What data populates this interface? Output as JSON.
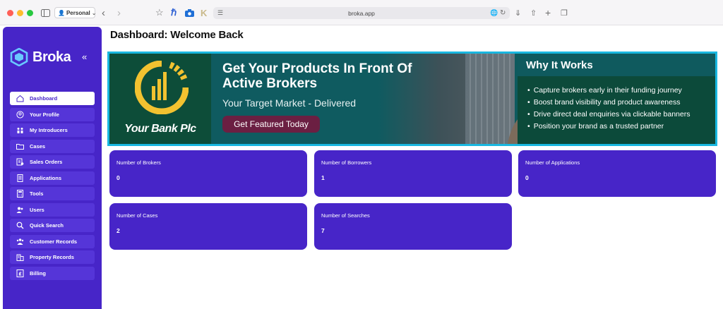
{
  "browser": {
    "profile_label": "Personal",
    "url": "broka.app"
  },
  "sidebar": {
    "brand_name": "Broka",
    "collapse_glyph": "«",
    "items": [
      {
        "label": "Dashboard",
        "icon": "home-icon",
        "active": true
      },
      {
        "label": "Your Profile",
        "icon": "user-circle-icon",
        "active": false
      },
      {
        "label": "My Introducers",
        "icon": "people-icon",
        "active": false
      },
      {
        "label": "Cases",
        "icon": "folder-icon",
        "active": false
      },
      {
        "label": "Sales Orders",
        "icon": "orders-icon",
        "active": false
      },
      {
        "label": "Applications",
        "icon": "document-icon",
        "active": false
      },
      {
        "label": "Tools",
        "icon": "calculator-icon",
        "active": false
      },
      {
        "label": "Users",
        "icon": "users-icon",
        "active": false
      },
      {
        "label": "Quick Search",
        "icon": "search-icon",
        "active": false
      },
      {
        "label": "Customer Records",
        "icon": "customers-icon",
        "active": false
      },
      {
        "label": "Property Records",
        "icon": "building-icon",
        "active": false
      },
      {
        "label": "Billing",
        "icon": "pound-icon",
        "active": false
      }
    ]
  },
  "main": {
    "title": "Dashboard: Welcome Back",
    "banner": {
      "bank_name": "Your Bank Plc",
      "headline": "Get Your Products In Front Of Active Brokers",
      "subheadline": "Your Target Market - Delivered",
      "cta_label": "Get Featured Today",
      "why_title": "Why It Works",
      "why_points": [
        "Capture brokers early in their funding journey",
        "Boost brand visibility and product awareness",
        "Drive direct deal enquiries via clickable banners",
        "Position your brand as a trusted partner"
      ]
    },
    "stats": [
      {
        "label": "Number of Brokers",
        "value": "0"
      },
      {
        "label": "Number of Borrowers",
        "value": "1"
      },
      {
        "label": "Number of Applications",
        "value": "0"
      },
      {
        "label": "Number of Cases",
        "value": "2"
      },
      {
        "label": "Number of Searches",
        "value": "7"
      }
    ]
  },
  "colors": {
    "brand_purple": "#4725c8",
    "banner_border": "#19b7e0",
    "bank_green": "#0d4d39",
    "bank_logo_yellow": "#f2c230",
    "cta_maroon": "#6b1f42"
  }
}
